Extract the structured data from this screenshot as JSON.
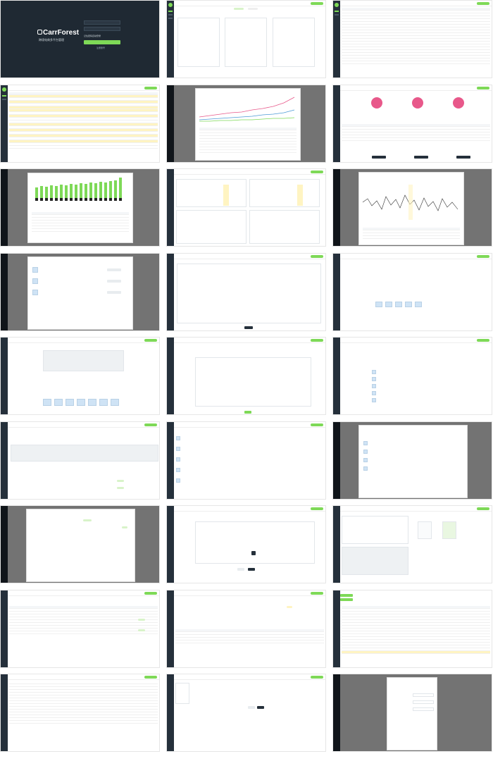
{
  "login": {
    "brand_name": "CarrForest",
    "subtitle": "跨境电商多平台管理",
    "username_label": "账号",
    "password_label": "密码",
    "remember_label": "记住密码自动登录",
    "signin_label": "登录",
    "register_label": "注册账号"
  },
  "colors": {
    "sidebar": "#25303b",
    "accent_green": "#7ed957",
    "highlight_yellow": "#fff4c2",
    "chart_pink": "#e8588a"
  },
  "icons": [
    "logo-icon",
    "nav-icon",
    "user-icon",
    "close-icon"
  ]
}
